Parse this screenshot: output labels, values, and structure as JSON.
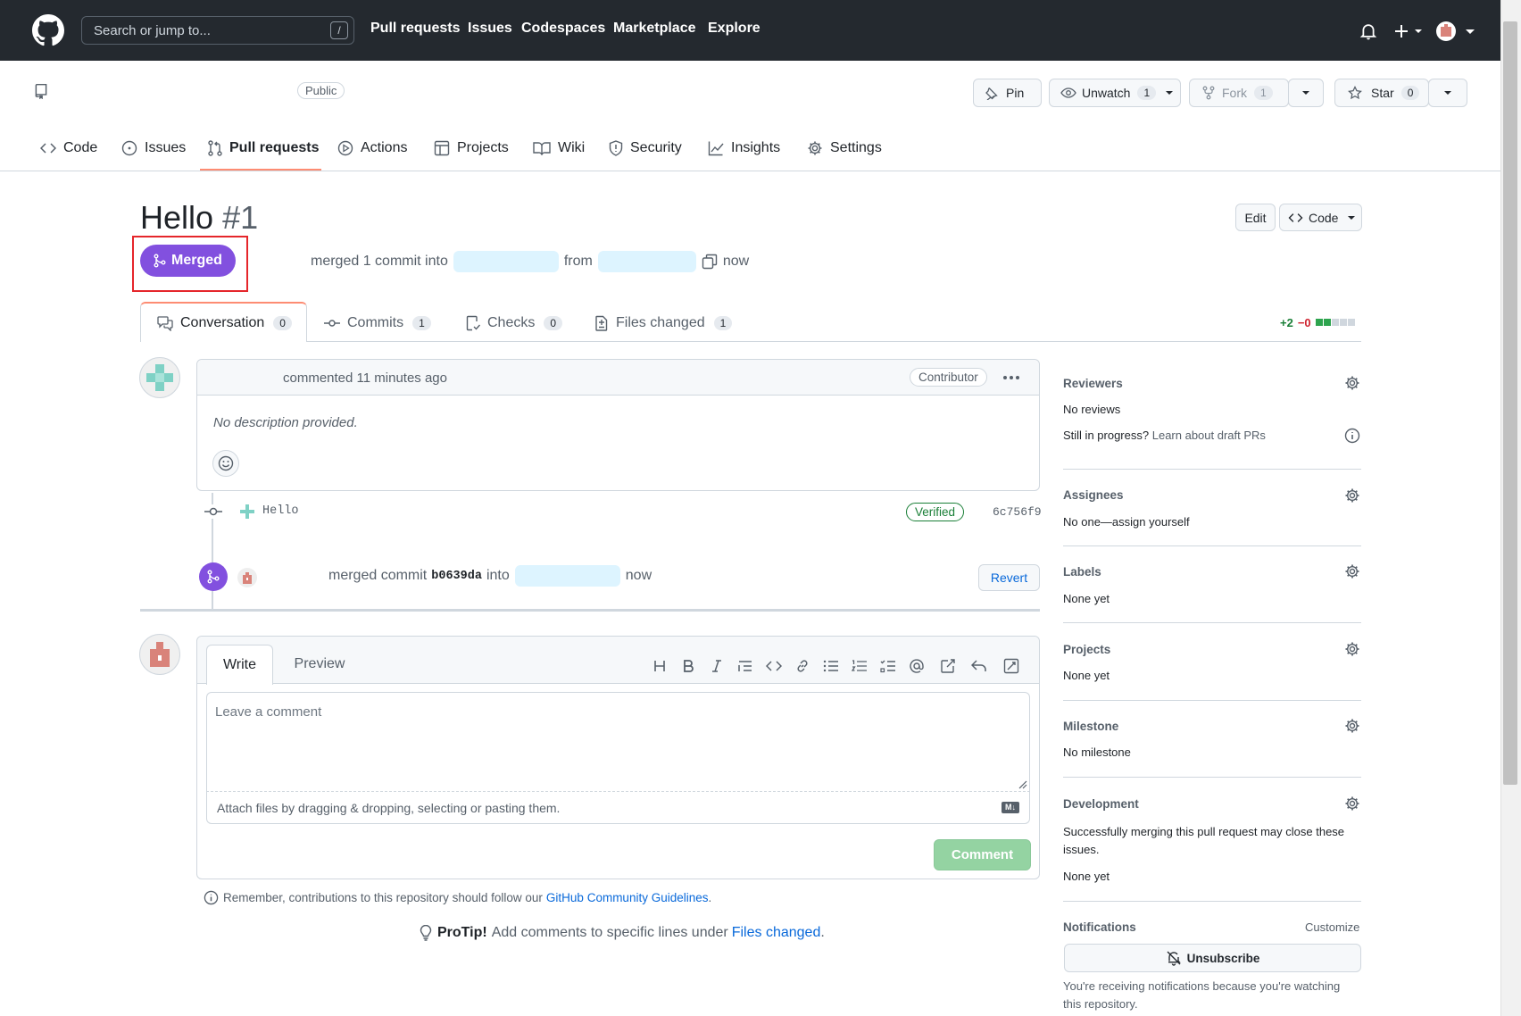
{
  "header": {
    "search_placeholder": "Search or jump to...",
    "search_shortcut": "/",
    "nav": [
      "Pull requests",
      "Issues",
      "Codespaces",
      "Marketplace",
      "Explore"
    ]
  },
  "repo": {
    "visibility": "Public",
    "pin_label": "Pin",
    "unwatch_label": "Unwatch",
    "unwatch_count": "1",
    "fork_label": "Fork",
    "fork_count": "1",
    "star_label": "Star",
    "star_count": "0"
  },
  "tabs": {
    "code": "Code",
    "issues": "Issues",
    "pulls": "Pull requests",
    "actions": "Actions",
    "projects": "Projects",
    "wiki": "Wiki",
    "security": "Security",
    "insights": "Insights",
    "settings": "Settings"
  },
  "pr": {
    "title": "Hello",
    "number": "#1",
    "edit_label": "Edit",
    "code_label": "Code",
    "state": "Merged",
    "meta_merged": "merged 1 commit into",
    "meta_from": "from",
    "meta_time": "now",
    "subtabs": {
      "conversation": "Conversation",
      "conversation_count": "0",
      "commits": "Commits",
      "commits_count": "1",
      "checks": "Checks",
      "checks_count": "0",
      "files": "Files changed",
      "files_count": "1"
    },
    "diffstat_add": "+2",
    "diffstat_del": "−0"
  },
  "comment": {
    "header_text": "commented 11 minutes ago",
    "role_badge": "Contributor",
    "body": "No description provided."
  },
  "commit": {
    "message": "Hello",
    "verified": "Verified",
    "sha": "6c756f9"
  },
  "merge_event": {
    "text1": "merged commit",
    "sha": "b0639da",
    "text2": "into",
    "time": "now",
    "revert_label": "Revert"
  },
  "editor": {
    "tab_write": "Write",
    "tab_preview": "Preview",
    "placeholder": "Leave a comment",
    "attach_hint": "Attach files by dragging & dropping, selecting or pasting them.",
    "submit_label": "Comment",
    "md_badge": "M↓"
  },
  "guidelines": {
    "prefix": "Remember, contributions to this repository should follow our",
    "link": "GitHub Community Guidelines",
    "suffix": "."
  },
  "protip": {
    "bold": "ProTip!",
    "text": "Add comments to specific lines under",
    "link": "Files changed",
    "suffix": "."
  },
  "sidebar": {
    "reviewers": {
      "title": "Reviewers",
      "value": "No reviews",
      "draft_prefix": "Still in progress?",
      "draft_link": "Learn about draft PRs"
    },
    "assignees": {
      "title": "Assignees",
      "value": "No one—assign yourself"
    },
    "labels": {
      "title": "Labels",
      "value": "None yet"
    },
    "projects": {
      "title": "Projects",
      "value": "None yet"
    },
    "milestone": {
      "title": "Milestone",
      "value": "No milestone"
    },
    "development": {
      "title": "Development",
      "desc": "Successfully merging this pull request may close these issues.",
      "value": "None yet"
    },
    "notifications": {
      "title": "Notifications",
      "customize": "Customize",
      "unsubscribe": "Unsubscribe",
      "reason": "You're receiving notifications because you're watching this repository."
    }
  },
  "colors": {
    "header_bg": "#24292f",
    "merged_purple": "#8250df",
    "link_blue": "#0969da",
    "green": "#1a7f37",
    "red": "#cf222e",
    "annotation_red": "#e5262b"
  }
}
